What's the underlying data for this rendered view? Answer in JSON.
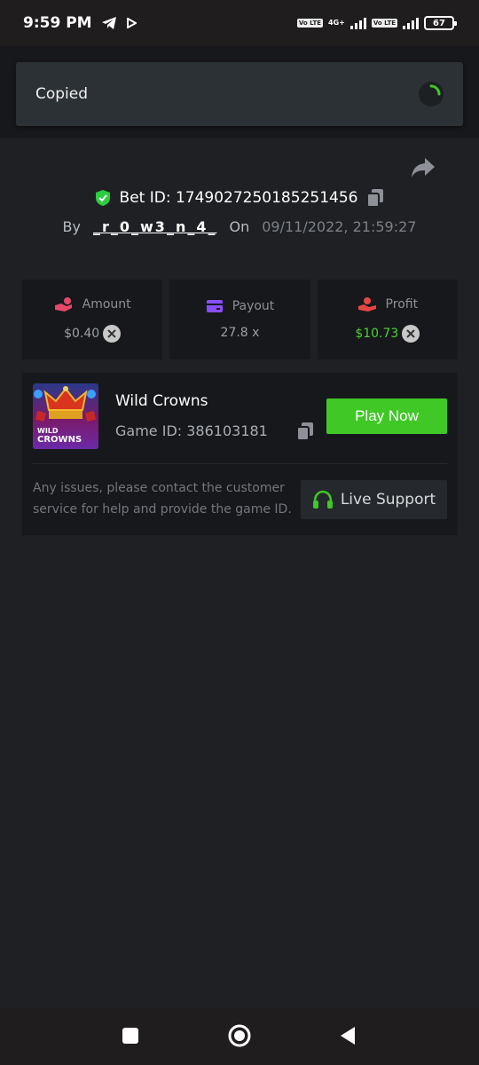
{
  "status_bar": {
    "time": "9:59 PM",
    "net1": "Vo LTE",
    "net_gen": "4G+",
    "net2": "Vo LTE",
    "battery": "67"
  },
  "toast": {
    "text": "Copied"
  },
  "bet": {
    "label": "Bet ID: 1749027250185251456",
    "by_label": "By",
    "username": "_r_0_w3_n_4_",
    "on_label": "On",
    "date": "09/11/2022, 21:59:27"
  },
  "stats": {
    "amount_label": "Amount",
    "amount_value": "$0.40",
    "payout_label": "Payout",
    "payout_value": "27.8 x",
    "profit_label": "Profit",
    "profit_value": "$10.73"
  },
  "game": {
    "thumb_line1": "WILD",
    "thumb_line2": "CROWNS",
    "name": "Wild Crowns",
    "id_label": "Game ID: 386103181",
    "play_label": "Play Now",
    "help_text": "Any issues, please contact the customer service for help and provide the game ID.",
    "support_label": "Live Support"
  },
  "colors": {
    "background": "#1e2023",
    "panel": "#17181b",
    "accent_green": "#3fc826",
    "profit_green": "#4cd137",
    "amount_pink": "#e8476a",
    "payout_purple": "#8a4dff",
    "profit_red": "#e84545"
  },
  "icons": [
    "telegram-icon",
    "play-icon",
    "shield-check-icon",
    "copy-icon",
    "share-icon",
    "hand-coin-icon",
    "card-icon",
    "hand-money-icon",
    "coin-x-icon",
    "headset-icon",
    "square-nav-icon",
    "circle-nav-icon",
    "back-nav-icon"
  ]
}
